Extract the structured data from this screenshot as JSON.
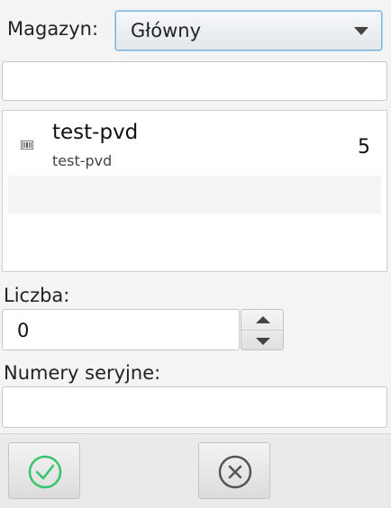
{
  "warehouse": {
    "label": "Magazyn:",
    "selected": "Główny"
  },
  "search": {
    "value": "",
    "placeholder": ""
  },
  "items": [
    {
      "name": "test-pvd",
      "code": "test-pvd",
      "quantity": "5",
      "icon": "barcode-icon"
    }
  ],
  "count": {
    "label": "Liczba:",
    "value": "0"
  },
  "serial": {
    "label": "Numery seryjne:",
    "value": ""
  },
  "actions": {
    "confirm_icon": "check-circle-icon",
    "cancel_icon": "x-circle-icon"
  },
  "colors": {
    "confirm": "#35c46b",
    "cancel": "#555555",
    "select_focus": "#7fb6dd"
  }
}
